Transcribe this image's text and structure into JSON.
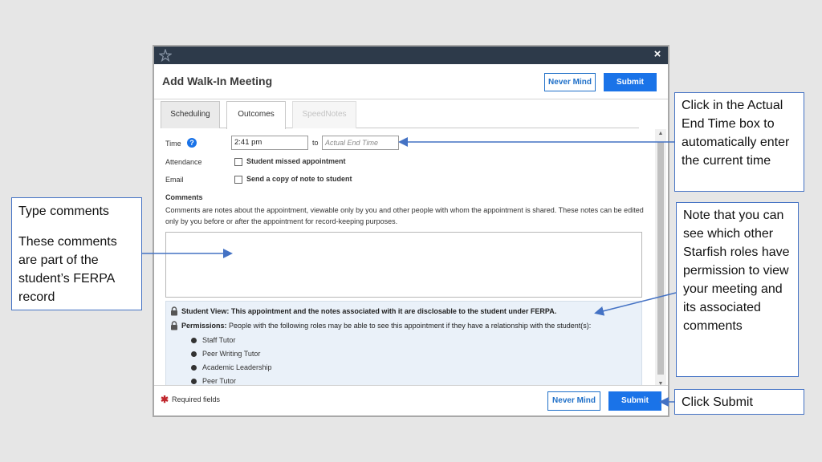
{
  "modal": {
    "title": "Add Walk-In Meeting",
    "close_label": "×",
    "header_buttons": {
      "never_mind": "Never Mind",
      "submit": "Submit"
    },
    "tabs": [
      {
        "label": "Scheduling",
        "state": "inactive"
      },
      {
        "label": "Outcomes",
        "state": "active"
      },
      {
        "label": "SpeedNotes",
        "state": "disabled"
      }
    ],
    "form": {
      "time_label": "Time",
      "time_value": "2:41 pm",
      "to_label": "to",
      "end_time_placeholder": "Actual End Time",
      "attendance_label": "Attendance",
      "attendance_option": "Student missed appointment",
      "email_label": "Email",
      "email_option": "Send a copy of note to student",
      "comments_label": "Comments",
      "comments_description": "Comments are notes about the appointment, viewable only by you and other people with whom the appointment is shared. These notes can be edited only by you before or after the appointment for record-keeping purposes.",
      "comments_value": ""
    },
    "permissions": {
      "student_view_label": "Student View:",
      "student_view_text": "This appointment and the notes associated with it are disclosable to the student under FERPA.",
      "permissions_label": "Permissions:",
      "permissions_text": "People with the following roles may be able to see this appointment if they have a relationship with the student(s):",
      "roles": [
        "Staff Tutor",
        "Peer Writing Tutor",
        "Academic Leadership",
        "Peer Tutor"
      ]
    },
    "footer": {
      "required_marker": "✱",
      "required_text": "Required fields",
      "never_mind": "Never Mind",
      "submit": "Submit"
    }
  },
  "callouts": {
    "type_comments_title": "Type comments",
    "type_comments_body": "These comments are part of the student’s FERPA record",
    "end_time": "Click in the Actual End Time box to automatically enter the current time",
    "permissions": "Note that you can see which other Starfish roles have permission to view your meeting and its associated comments",
    "submit": "Click Submit"
  },
  "colors": {
    "titlebar": "#2d3a4a",
    "primary": "#1a73e8",
    "callout_border": "#4472c4",
    "permissions_bg": "#eaf1f9",
    "required_star": "#c0262c"
  }
}
